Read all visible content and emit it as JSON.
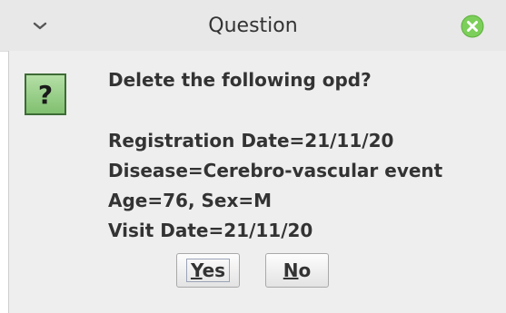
{
  "window": {
    "title": "Question",
    "menu_icon": "chevron-down-icon",
    "close_icon": "close-icon",
    "close_color": "#7ccf5a"
  },
  "dialog": {
    "icon": "question-icon",
    "icon_glyph": "?",
    "icon_color": "#5fa35a",
    "prompt": "Delete the following opd?",
    "details": [
      "Registration Date=21/11/20",
      "Disease=Cerebro-vascular event",
      "Age=76, Sex=M",
      "Visit Date=21/11/20"
    ]
  },
  "buttons": {
    "yes": {
      "mnemonic": "Y",
      "rest": "es"
    },
    "no": {
      "mnemonic": "N",
      "rest": "o"
    }
  }
}
